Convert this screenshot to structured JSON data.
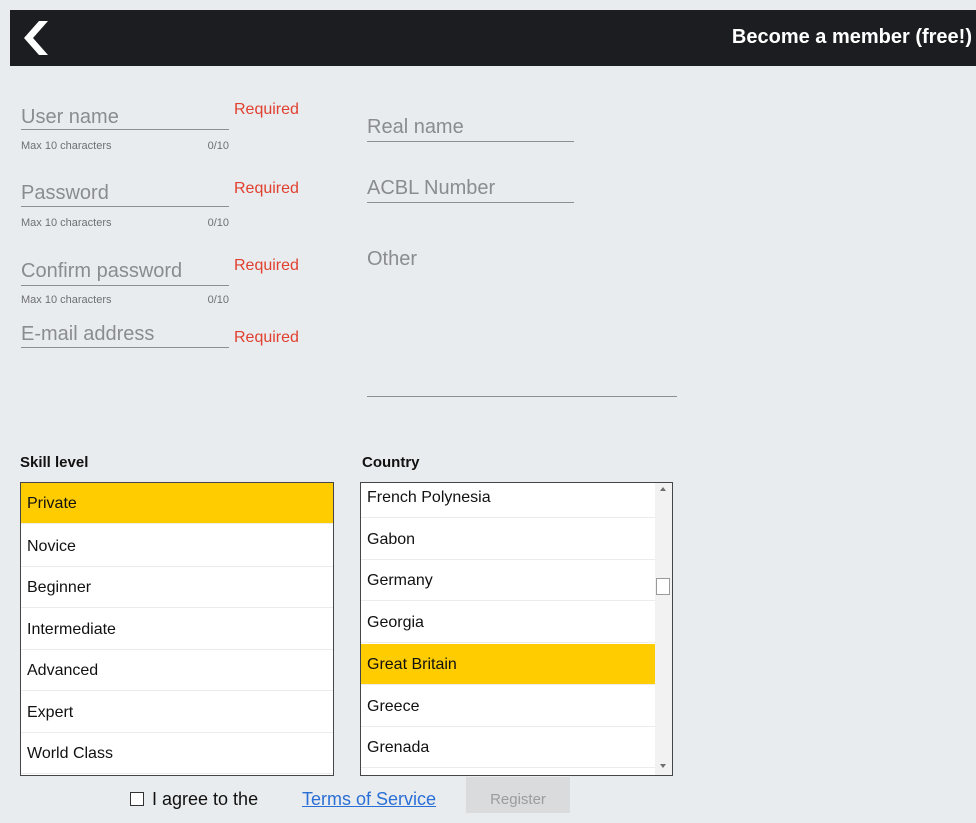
{
  "header": {
    "title": "Become a member (free!)",
    "back_icon": "chevron-left-icon"
  },
  "form": {
    "username": {
      "placeholder": "User name",
      "required": "Required",
      "hint": "Max 10 characters",
      "count": "0/10"
    },
    "password": {
      "placeholder": "Password",
      "required": "Required",
      "hint": "Max 10 characters",
      "count": "0/10"
    },
    "confirm_password": {
      "placeholder": "Confirm password",
      "required": "Required",
      "hint": "Max 10 characters",
      "count": "0/10"
    },
    "email": {
      "placeholder": "E-mail address",
      "required": "Required"
    },
    "real_name": {
      "placeholder": "Real name"
    },
    "acbl_number": {
      "placeholder": "ACBL Number"
    },
    "other": {
      "placeholder": "Other"
    }
  },
  "skill": {
    "label": "Skill level",
    "items": [
      "Private",
      "Novice",
      "Beginner",
      "Intermediate",
      "Advanced",
      "Expert",
      "World Class"
    ],
    "selected": "Private"
  },
  "country": {
    "label": "Country",
    "items": [
      "French Polynesia",
      "Gabon",
      "Germany",
      "Georgia",
      "Great Britain",
      "Greece",
      "Grenada"
    ],
    "selected": "Great Britain"
  },
  "agree": {
    "text": "I agree to the",
    "link": "Terms of Service"
  },
  "register": {
    "label": "Register"
  },
  "colors": {
    "header_bg": "#1c1d20",
    "page_bg": "#e9ecee",
    "required_red": "#e0402f",
    "selected_yellow": "#ffcc00",
    "link_blue": "#2a6fd6"
  }
}
